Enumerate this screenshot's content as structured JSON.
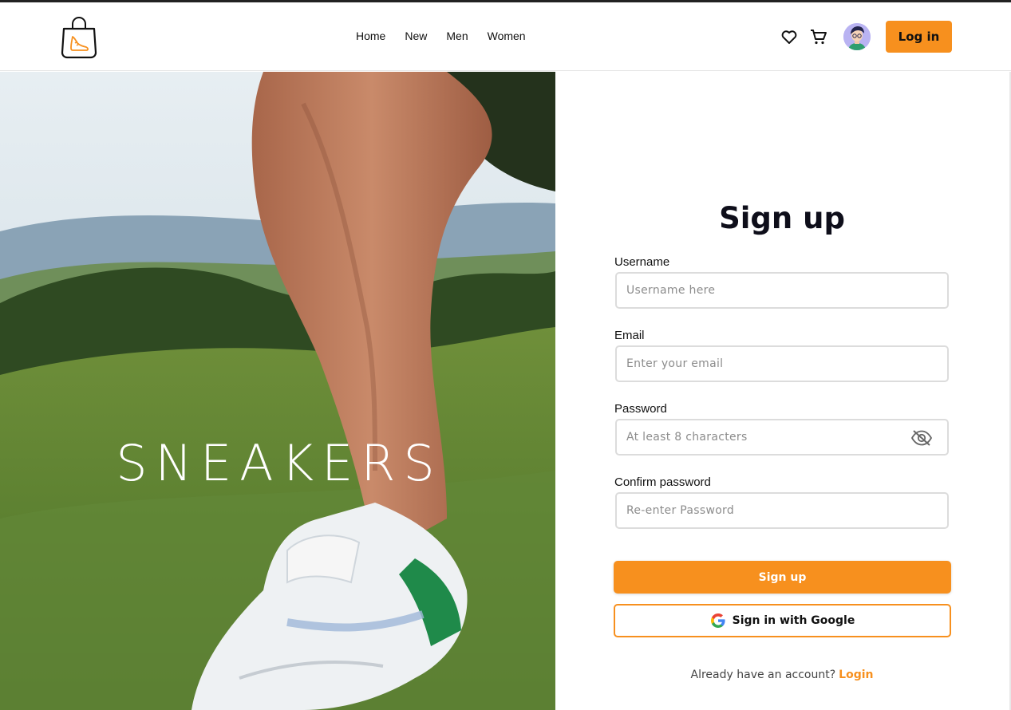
{
  "nav": {
    "links": [
      "Home",
      "New",
      "Men",
      "Women"
    ],
    "login_label": "Log in",
    "icons": [
      "heart-icon",
      "cart-icon"
    ]
  },
  "hero": {
    "title": "SNEAKERS"
  },
  "form": {
    "title": "Sign up",
    "fields": {
      "username": {
        "label": "Username",
        "placeholder": "Username here"
      },
      "email": {
        "label": "Email",
        "placeholder": "Enter your email"
      },
      "password": {
        "label": "Password",
        "placeholder": "At least 8 characters"
      },
      "confirm": {
        "label": "Confirm password",
        "placeholder": "Re-enter Password"
      }
    },
    "signup_label": "Sign up",
    "google_label": "Sign in with Google",
    "account_text": "Already have an account?",
    "login_link": "Login"
  },
  "colors": {
    "accent": "#f7901e",
    "title": "#0e0e1a",
    "border": "#dcdcdc"
  }
}
